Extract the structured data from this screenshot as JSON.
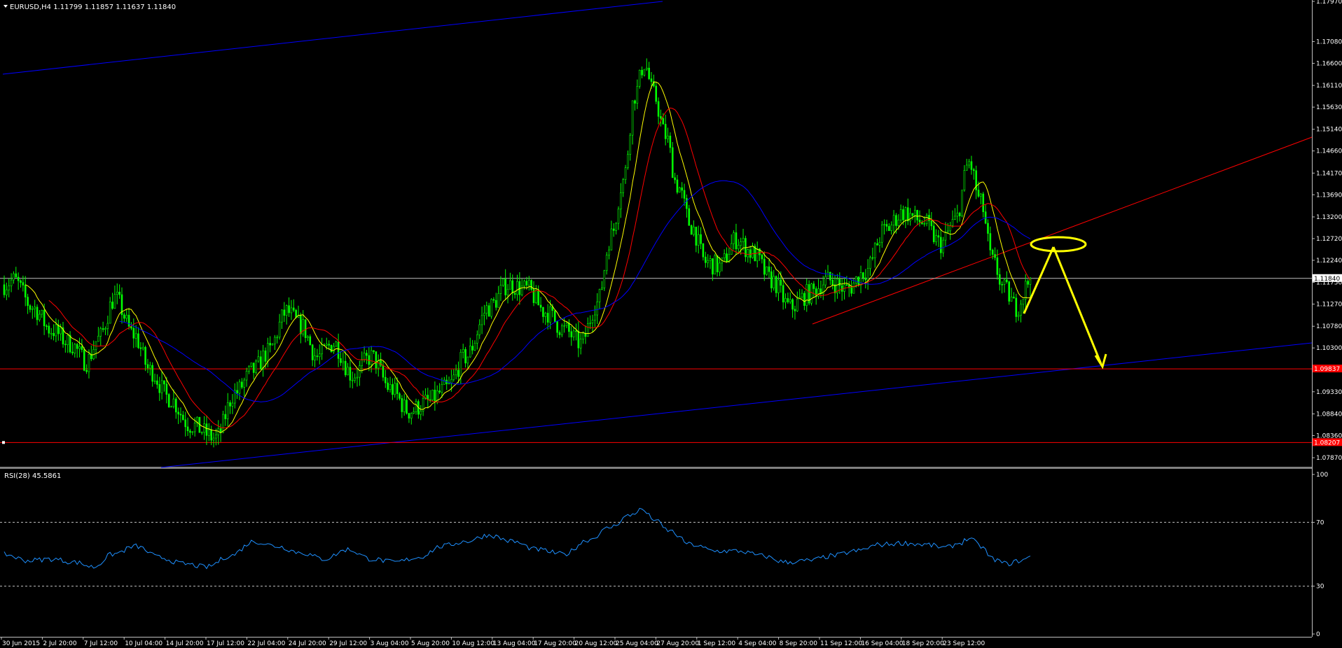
{
  "header": {
    "symbol_line": "EURUSD,H4  1.11799 1.11857 1.11637 1.11840",
    "rsi_line": "RSI(28) 45.5861"
  },
  "colors": {
    "background": "#000000",
    "bull": "#00ff00",
    "bear": "#00ff00",
    "ma_fast": "#ffff00",
    "ma_mid": "#ff0000",
    "ma_slow": "#0000ff",
    "channel": "#0000ff",
    "trendline": "#ff0000",
    "hline": "#ff0000",
    "rsi": "#1e90ff",
    "annotation": "#ffff00"
  },
  "chart_data": [
    {
      "type": "candlestick",
      "symbol": "EURUSD",
      "timeframe": "H4",
      "ylim": [
        1.0767,
        1.1797
      ],
      "y_ticks": [
        "1.17970",
        "1.17080",
        "1.16600",
        "1.16110",
        "1.15630",
        "1.15140",
        "1.14660",
        "1.14170",
        "1.13690",
        "1.13200",
        "1.12720",
        "1.12240",
        "1.11750",
        "1.11270",
        "1.10780",
        "1.10300",
        "1.09810",
        "1.09330",
        "1.08840",
        "1.08360",
        "1.07870"
      ],
      "x_ticks": [
        "30 Jun 2015",
        "2 Jul 20:00",
        "7 Jul 12:00",
        "10 Jul 04:00",
        "14 Jul 20:00",
        "17 Jul 12:00",
        "22 Jul 04:00",
        "24 Jul 20:00",
        "29 Jul 12:00",
        "3 Aug 04:00",
        "5 Aug 20:00",
        "10 Aug 12:00",
        "13 Aug 04:00",
        "17 Aug 20:00",
        "20 Aug 12:00",
        "25 Aug 04:00",
        "27 Aug 20:00",
        "1 Sep 12:00",
        "4 Sep 04:00",
        "8 Sep 20:00",
        "11 Sep 12:00",
        "16 Sep 04:00",
        "18 Sep 20:00",
        "23 Sep 12:00"
      ],
      "current_price": "1.11840",
      "price_levels": [
        "1.09837",
        "1.08207"
      ],
      "anchors": [
        [
          0,
          1.117
        ],
        [
          4,
          1.118
        ],
        [
          12,
          1.112
        ],
        [
          20,
          1.107
        ],
        [
          28,
          1.104
        ],
        [
          35,
          1.1
        ],
        [
          40,
          1.105
        ],
        [
          47,
          1.114
        ],
        [
          55,
          1.106
        ],
        [
          62,
          1.098
        ],
        [
          70,
          1.092
        ],
        [
          79,
          1.086
        ],
        [
          90,
          1.083
        ],
        [
          98,
          1.093
        ],
        [
          106,
          1.098
        ],
        [
          112,
          1.102
        ],
        [
          120,
          1.111
        ],
        [
          126,
          1.108
        ],
        [
          133,
          1.101
        ],
        [
          140,
          1.104
        ],
        [
          148,
          1.097
        ],
        [
          156,
          1.101
        ],
        [
          164,
          1.094
        ],
        [
          172,
          1.089
        ],
        [
          180,
          1.091
        ],
        [
          188,
          1.094
        ],
        [
          196,
          1.101
        ],
        [
          206,
          1.112
        ],
        [
          214,
          1.117
        ],
        [
          222,
          1.116
        ],
        [
          230,
          1.111
        ],
        [
          238,
          1.107
        ],
        [
          245,
          1.104
        ],
        [
          252,
          1.113
        ],
        [
          258,
          1.128
        ],
        [
          263,
          1.14
        ],
        [
          268,
          1.159
        ],
        [
          272,
          1.166
        ],
        [
          276,
          1.159
        ],
        [
          281,
          1.15
        ],
        [
          286,
          1.139
        ],
        [
          292,
          1.13
        ],
        [
          298,
          1.122
        ],
        [
          304,
          1.121
        ],
        [
          311,
          1.127
        ],
        [
          318,
          1.124
        ],
        [
          326,
          1.118
        ],
        [
          334,
          1.112
        ],
        [
          342,
          1.115
        ],
        [
          350,
          1.118
        ],
        [
          358,
          1.116
        ],
        [
          366,
          1.12
        ],
        [
          374,
          1.129
        ],
        [
          382,
          1.133
        ],
        [
          390,
          1.131
        ],
        [
          398,
          1.126
        ],
        [
          404,
          1.131
        ],
        [
          410,
          1.144
        ],
        [
          415,
          1.135
        ],
        [
          420,
          1.122
        ],
        [
          425,
          1.116
        ],
        [
          430,
          1.112
        ],
        [
          436,
          1.118
        ]
      ],
      "ma_periods": [
        10,
        20,
        50
      ]
    },
    {
      "type": "line",
      "name": "RSI(28)",
      "ylim": [
        0,
        100
      ],
      "levels": [
        30,
        70
      ],
      "y_ticks": [
        "100",
        "70",
        "30",
        "0"
      ],
      "anchors": [
        [
          0,
          50
        ],
        [
          10,
          46
        ],
        [
          20,
          47
        ],
        [
          30,
          45
        ],
        [
          38,
          42
        ],
        [
          46,
          50
        ],
        [
          56,
          55
        ],
        [
          66,
          48
        ],
        [
          76,
          44
        ],
        [
          86,
          42
        ],
        [
          96,
          49
        ],
        [
          106,
          58
        ],
        [
          116,
          55
        ],
        [
          126,
          51
        ],
        [
          136,
          47
        ],
        [
          146,
          53
        ],
        [
          156,
          47
        ],
        [
          166,
          45
        ],
        [
          176,
          48
        ],
        [
          186,
          55
        ],
        [
          196,
          58
        ],
        [
          206,
          62
        ],
        [
          216,
          58
        ],
        [
          226,
          53
        ],
        [
          238,
          50
        ],
        [
          248,
          59
        ],
        [
          258,
          67
        ],
        [
          265,
          74
        ],
        [
          271,
          78
        ],
        [
          276,
          72
        ],
        [
          282,
          65
        ],
        [
          292,
          56
        ],
        [
          302,
          52
        ],
        [
          312,
          52
        ],
        [
          322,
          49
        ],
        [
          332,
          45
        ],
        [
          342,
          46
        ],
        [
          352,
          49
        ],
        [
          362,
          52
        ],
        [
          372,
          56
        ],
        [
          382,
          57
        ],
        [
          392,
          56
        ],
        [
          400,
          54
        ],
        [
          406,
          57
        ],
        [
          410,
          60
        ],
        [
          415,
          55
        ],
        [
          420,
          47
        ],
        [
          426,
          44
        ],
        [
          432,
          46
        ],
        [
          436,
          48
        ]
      ]
    }
  ]
}
